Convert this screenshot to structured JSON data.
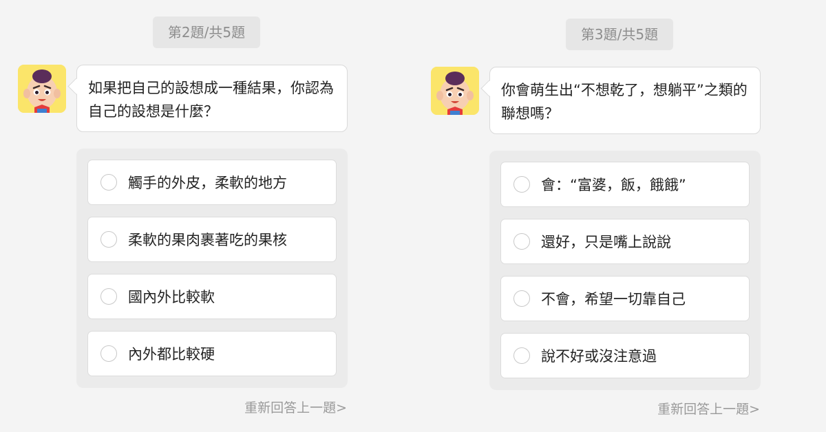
{
  "panels": [
    {
      "counter": "第2題/共5題",
      "question": "如果把自己的設想成一種結果，你認為自己的設想是什麼？",
      "options": [
        "觸手的外皮，柔軟的地方",
        "柔軟的果肉裹著吃的果核",
        "國內外比較軟",
        "內外都比較硬"
      ],
      "redo_label": "重新回答上一題>"
    },
    {
      "counter": "第3題/共5題",
      "question": "你會萌生出“不想乾了，想躺平”之類的聯想嗎？",
      "options": [
        "會：“富婆，飯，餓餓”",
        "還好，只是嘴上說說",
        "不會，希望一切靠自己",
        "說不好或沒注意過"
      ],
      "redo_label": "重新回答上一題>"
    }
  ],
  "avatar_icon": "cartoon-boy-avatar-icon",
  "colors": {
    "background": "#f4f4f4",
    "avatar_bg": "#fbe56a",
    "badge_bg": "#e6e6e6",
    "options_box_bg": "#ebebeb",
    "muted_text": "#9a9a9a"
  }
}
